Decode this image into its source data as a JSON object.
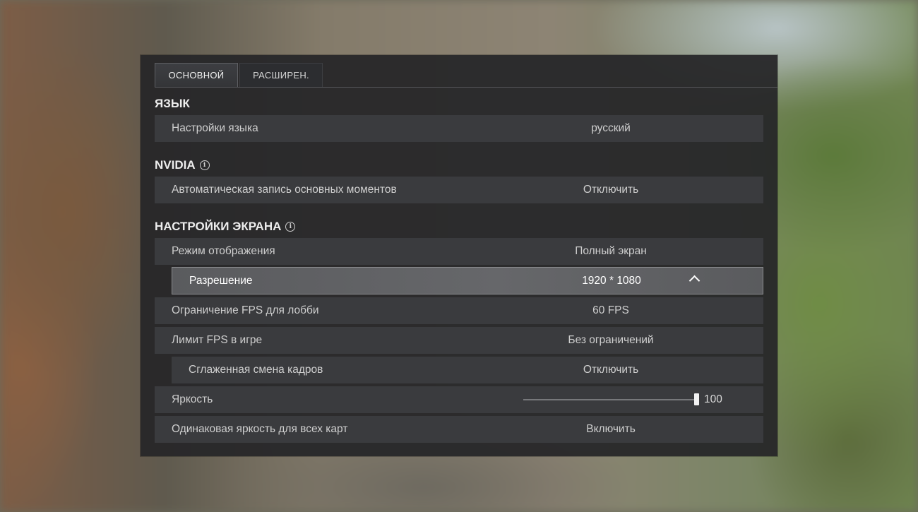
{
  "tabs": [
    {
      "label": "ОСНОВНОЙ",
      "active": true
    },
    {
      "label": "РАСШИРЕН.",
      "active": false
    }
  ],
  "sections": {
    "language": {
      "title": "ЯЗЫК",
      "rows": [
        {
          "label": "Настройки языка",
          "value": "русский"
        }
      ]
    },
    "nvidia": {
      "title": "NVIDIA",
      "info_icon": "info-icon",
      "rows": [
        {
          "label": "Автоматическая запись основных моментов",
          "value": "Отключить"
        }
      ]
    },
    "display": {
      "title": "НАСТРОЙКИ ЭКРАНА",
      "info_icon": "info-icon",
      "rows": [
        {
          "label": "Режим отображения",
          "value": "Полный экран"
        },
        {
          "label": "Разрешение",
          "value": "1920 * 1080",
          "expanded": true,
          "icon": "chevron-up-icon"
        },
        {
          "label": "Ограничение FPS для лобби",
          "value": "60 FPS"
        },
        {
          "label": "Лимит FPS в игре",
          "value": "Без ограничений"
        },
        {
          "label": "Сглаженная смена кадров",
          "value": "Отключить"
        },
        {
          "label": "Яркость",
          "value": "100",
          "slider_fraction": 1.0
        },
        {
          "label": "Одинаковая яркость для всех карт",
          "value": "Включить"
        }
      ]
    }
  },
  "colors": {
    "panel_bg": "#262628",
    "row_bg": "#3a3b3e",
    "row_highlight": "#66676a",
    "text": "#cfcfcf"
  }
}
